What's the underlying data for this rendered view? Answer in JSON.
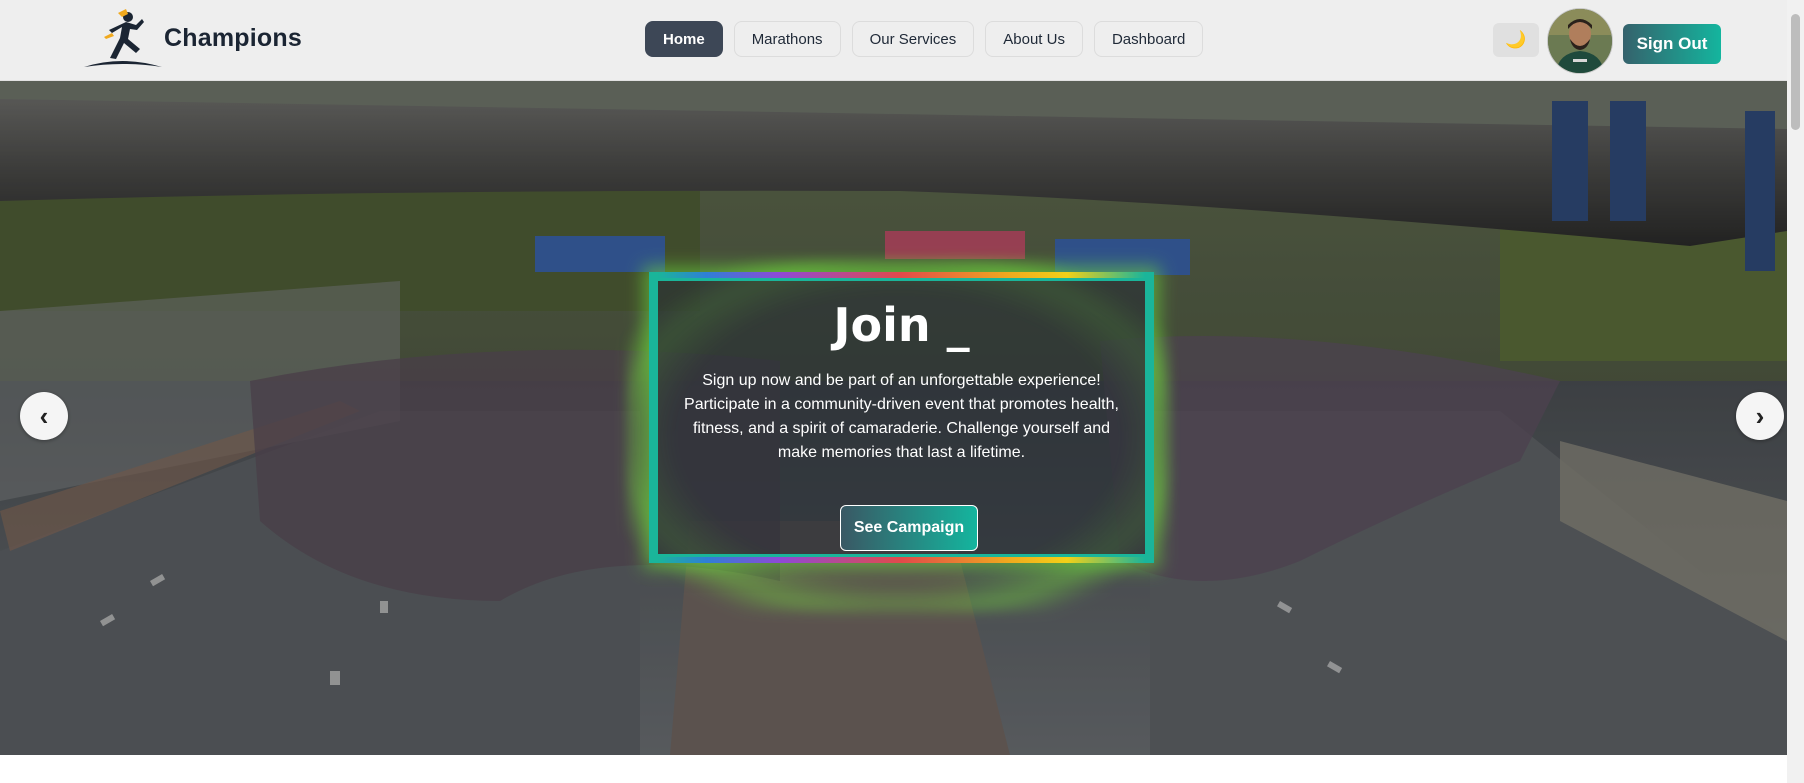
{
  "navbar": {
    "brand_name": "Champions",
    "links": [
      {
        "label": "Home",
        "active": true
      },
      {
        "label": "Marathons",
        "active": false
      },
      {
        "label": "Our Services",
        "active": false
      },
      {
        "label": "About Us",
        "active": false
      },
      {
        "label": "Dashboard",
        "active": false
      }
    ],
    "theme_toggle_icon": "🌙",
    "avatar_icon": "user-avatar",
    "signout_label": "Sign Out"
  },
  "hero": {
    "title": "Join _",
    "description": "Sign up now and be part of an unforgettable experience! Participate in a community-driven event that promotes health, fitness, and a spirit of camaraderie. Challenge yourself and make memories that last a lifetime.",
    "cta_label": "See Campaign",
    "prev_arrow": "‹",
    "next_arrow": "›",
    "frame_color": "#1ab59a",
    "glow_color": "#78e63c"
  },
  "colors": {
    "nav_bg": "#eeeeee",
    "active_link_bg": "#3d4756",
    "button_gradient_start": "#35626c",
    "button_gradient_end": "#14b59e"
  }
}
